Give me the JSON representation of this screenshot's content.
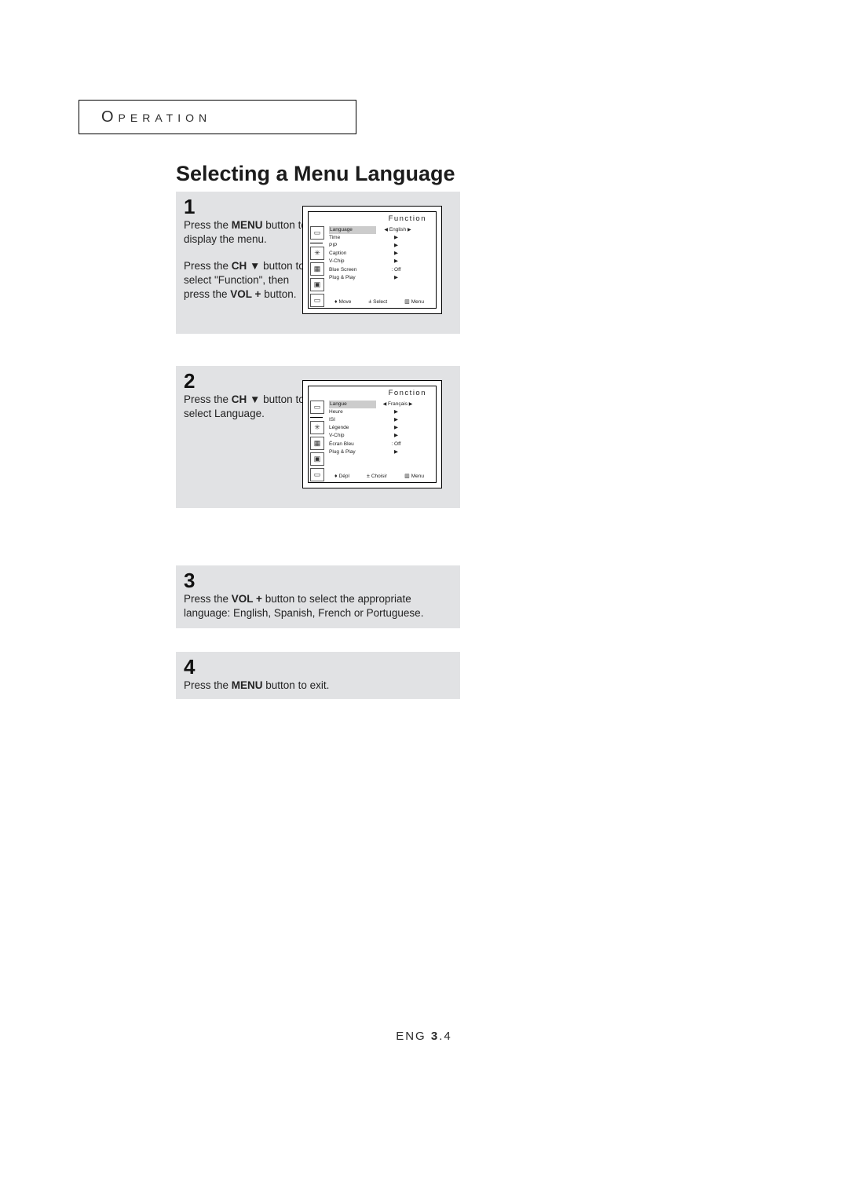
{
  "section_label": "Operation",
  "heading": "Selecting a Menu Language",
  "steps": {
    "s1": {
      "num": "1",
      "p1_a": "Press the ",
      "p1_b": "MENU",
      "p1_c": " button to display the menu.",
      "p2_a": "Press the ",
      "p2_b": "CH ▼",
      "p2_c": " button to select \"Function\", then press the ",
      "p2_d": "VOL +",
      "p2_e": " button."
    },
    "s2": {
      "num": "2",
      "p1_a": "Press the ",
      "p1_b": "CH ▼",
      "p1_c": " button to select Language."
    },
    "s3": {
      "num": "3",
      "p1_a": "Press the ",
      "p1_b": "VOL +",
      "p1_c": " button to select the appropriate language: English, Spanish, French or Portuguese."
    },
    "s4": {
      "num": "4",
      "p1_a": "Press the ",
      "p1_b": "MENU",
      "p1_c": " button to exit."
    }
  },
  "osd1": {
    "title": "Function",
    "rows": [
      {
        "label": "Language",
        "value_l": "◀",
        "value": "English",
        "value_r": "▶",
        "hi": true
      },
      {
        "label": "Time",
        "value_l": "",
        "value": "▶",
        "value_r": ""
      },
      {
        "label": "PIP",
        "value_l": "",
        "value": "▶",
        "value_r": ""
      },
      {
        "label": "Caption",
        "value_l": "",
        "value": "▶",
        "value_r": ""
      },
      {
        "label": "V-Chip",
        "value_l": "",
        "value": "▶",
        "value_r": ""
      },
      {
        "label": "Blue Screen",
        "value_l": "",
        "value": ": Off",
        "value_r": ""
      },
      {
        "label": "Plug & Play",
        "value_l": "",
        "value": "▶",
        "value_r": ""
      }
    ],
    "foot": {
      "move_sym": "♦",
      "move": "Move",
      "sel_sym": "±",
      "sel": "Select",
      "menu_sym": "▥",
      "menu": "Menu"
    }
  },
  "osd2": {
    "title": "Fonction",
    "rows": [
      {
        "label": "Langue",
        "value_l": "◀",
        "value": "Français",
        "value_r": "▶",
        "hi": true
      },
      {
        "label": "Heure",
        "value_l": "",
        "value": "▶",
        "value_r": ""
      },
      {
        "label": "ISI",
        "value_l": "",
        "value": "▶",
        "value_r": ""
      },
      {
        "label": "Légende",
        "value_l": "",
        "value": "▶",
        "value_r": ""
      },
      {
        "label": "V-Chip",
        "value_l": "",
        "value": "▶",
        "value_r": ""
      },
      {
        "label": "Écran Bleu",
        "value_l": "",
        "value": ": Off",
        "value_r": ""
      },
      {
        "label": "Plug & Play",
        "value_l": "",
        "value": "▶",
        "value_r": ""
      }
    ],
    "foot": {
      "move_sym": "♦",
      "move": "Dépl",
      "sel_sym": "±",
      "sel": "Choisir",
      "menu_sym": "▥",
      "menu": "Menu"
    }
  },
  "sidebar_icons": [
    "▭",
    "✳",
    "▦",
    "▣",
    "▭"
  ],
  "footer": {
    "lang": "ENG ",
    "chap": "3",
    "sep": ".",
    "page": "4"
  }
}
